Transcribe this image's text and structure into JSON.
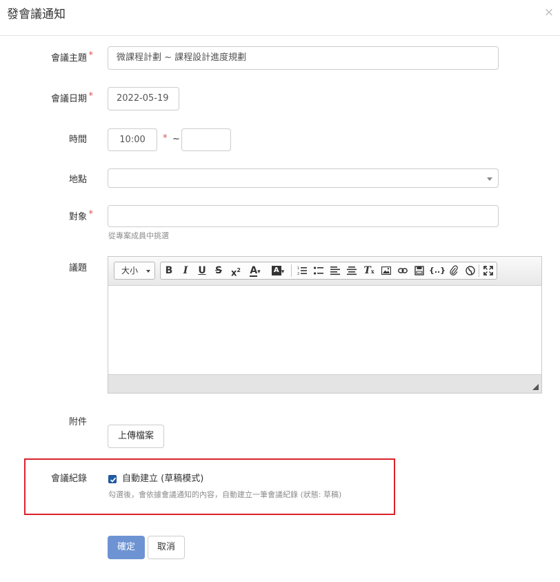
{
  "modal": {
    "title": "發會議通知",
    "close_glyph": "×"
  },
  "form": {
    "subject": {
      "label": "會議主題",
      "required_mark": "*",
      "value": "微課程計劃 ~ 課程設計進度規劃"
    },
    "date": {
      "label": "會議日期",
      "required_mark": "*",
      "value": "2022-05-19"
    },
    "time": {
      "label": "時間",
      "start_value": "10:00",
      "required_mark": "*",
      "separator": "~",
      "end_value": ""
    },
    "location": {
      "label": "地點",
      "selected": ""
    },
    "attendees": {
      "label": "對象",
      "required_mark": "*",
      "value": "",
      "hint": "從專案成員中挑選"
    },
    "agenda": {
      "label": "議題",
      "size_dropdown": "大小",
      "toolbar_icons": [
        "bold-icon",
        "italic-icon",
        "underline-icon",
        "strikethrough-icon",
        "superscript-icon",
        "font-color-icon",
        "highlight-color-icon",
        "ordered-list-icon",
        "unordered-list-icon",
        "align-left-icon",
        "align-center-icon",
        "clear-format-icon",
        "image-icon",
        "link-icon",
        "media-icon",
        "code-icon",
        "attachment-icon",
        "web-icon",
        "fullscreen-icon"
      ]
    },
    "attachment": {
      "label": "附件",
      "upload_button": "上傳檔案"
    },
    "minutes": {
      "label": "會議紀錄",
      "checkbox_checked": true,
      "checkbox_label": "自動建立 (草稿模式)",
      "hint": "勾選後，會依據會議通知的內容，自動建立一筆會議紀錄 (狀態: 草稿)"
    }
  },
  "actions": {
    "confirm": "確定",
    "cancel": "取消"
  },
  "colors": {
    "primary_button": "#6e93d3",
    "highlight_border": "#d9222a",
    "required_mark": "#d9534f"
  }
}
